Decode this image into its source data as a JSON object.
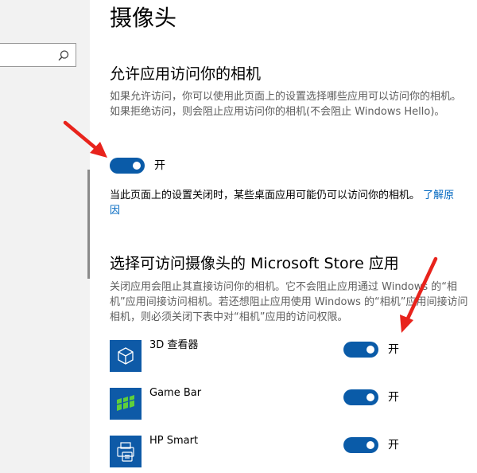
{
  "nav": {
    "search_placeholder": ""
  },
  "page": {
    "title": "摄像头"
  },
  "allow_access": {
    "heading": "允许应用访问你的相机",
    "description": "如果允许访问，你可以使用此页面上的设置选择哪些应用可以访问你的相机。如果拒绝访问，则会阻止应用访问你的相机(不会阻止 Windows Hello)。",
    "toggle_state": "开",
    "note": "当此页面上的设置关闭时，某些桌面应用可能仍可以访问你的相机。",
    "learn_more": "了解原因"
  },
  "store_apps": {
    "heading": "选择可访问摄像头的 Microsoft Store 应用",
    "description": "关闭应用会阻止其直接访问你的相机。它不会阻止应用通过 Windows 的“相机”应用间接访问相机。若还想阻止应用使用 Windows 的“相机”应用间接访问相机，则必须关闭下表中对“相机”应用的访问权限。",
    "apps": [
      {
        "name": "3D 查看器",
        "icon": "cube-icon",
        "state": "开"
      },
      {
        "name": "Game Bar",
        "icon": "game-bar-icon",
        "state": "开"
      },
      {
        "name": "HP Smart",
        "icon": "printer-icon",
        "state": "开"
      }
    ]
  },
  "colors": {
    "accent": "#0a5ba8",
    "tile": "#0e5aa7",
    "link": "#0067c0",
    "annotation": "#e8231c"
  }
}
